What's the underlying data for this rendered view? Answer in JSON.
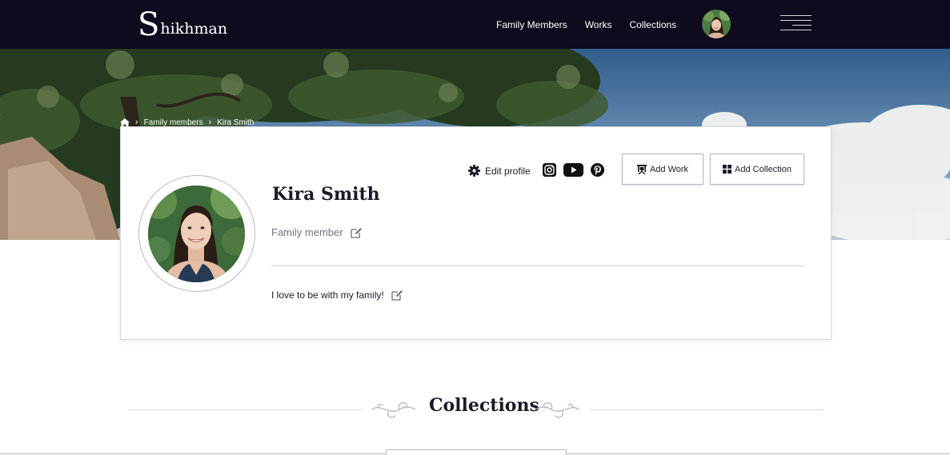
{
  "brand": {
    "initial": "S",
    "rest": "hikhman"
  },
  "nav": {
    "links": [
      {
        "label": "Family Members"
      },
      {
        "label": "Works"
      },
      {
        "label": "Collections"
      }
    ],
    "avatar_icon": "user-avatar",
    "menu_icon": "hamburger-icon"
  },
  "breadcrumb": {
    "home_icon": "home-icon",
    "items": [
      {
        "label": "Family members"
      },
      {
        "label": "Kira Smith"
      }
    ]
  },
  "profile": {
    "name": "Kira Smith",
    "role": "Family member",
    "bio": "I love to be with my family!",
    "edit_label": "Edit profile",
    "social_icons": [
      "instagram-icon",
      "youtube-icon",
      "pinterest-icon"
    ],
    "add_work_label": "Add Work",
    "add_collection_label": "Add Collection"
  },
  "collections": {
    "title": "Collections"
  },
  "colors": {
    "navbar": "#0f0a1e",
    "text": "#1c1a26",
    "muted": "#75717c",
    "border": "#b9b7c0",
    "ornament": "#b6b3c2"
  }
}
